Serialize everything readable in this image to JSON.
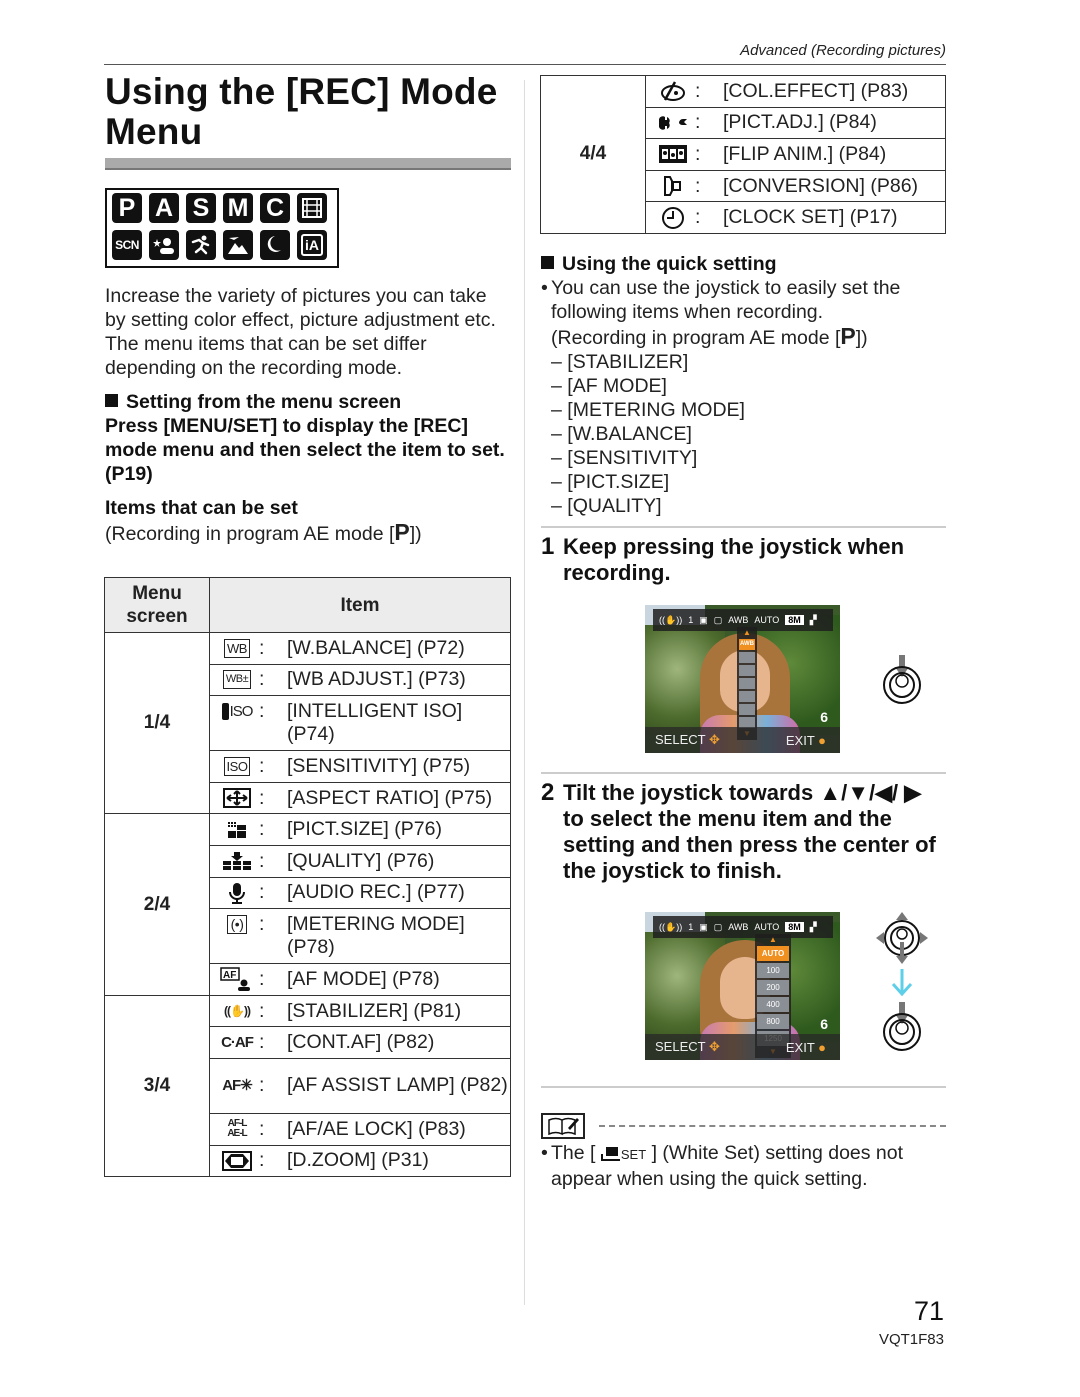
{
  "header": {
    "section": "Advanced (Recording pictures)"
  },
  "title": "Using the [REC] Mode Menu",
  "modes": {
    "row1": [
      {
        "label": "P",
        "icon": "program-ae-mode-icon"
      },
      {
        "label": "A",
        "icon": "aperture-priority-mode-icon"
      },
      {
        "label": "S",
        "icon": "shutter-priority-mode-icon"
      },
      {
        "label": "M",
        "icon": "manual-mode-icon"
      },
      {
        "label": "C",
        "icon": "custom-mode-icon"
      },
      {
        "label": "",
        "icon": "motion-picture-mode-icon"
      }
    ],
    "row2": [
      {
        "label": "SCN",
        "icon": "scene-mode-icon"
      },
      {
        "label": "",
        "icon": "portrait-mode-icon"
      },
      {
        "label": "",
        "icon": "sports-mode-icon"
      },
      {
        "label": "",
        "icon": "scenery-mode-icon"
      },
      {
        "label": "",
        "icon": "night-portrait-mode-icon"
      },
      {
        "label": "iA",
        "icon": "intelligent-auto-mode-icon"
      }
    ]
  },
  "intro": "Increase the variety of pictures you can take by setting color effect, picture adjustment etc. The menu items that can be set differ depending on the recording mode.",
  "menu_screen_section": {
    "heading": "Setting from the menu screen",
    "instruction": "Press [MENU/SET] to display the [REC] mode menu and then select the item to set. (P19)",
    "items_heading": "Items that can be set",
    "items_sub_prefix": "(Recording in program AE mode [",
    "items_sub_mode": "P",
    "items_sub_suffix": "])"
  },
  "table": {
    "headers": {
      "menu_screen": "Menu screen",
      "item": "Item"
    },
    "groups": [
      {
        "page": "1/4",
        "items": [
          {
            "icon_text": "WB",
            "icon": "white-balance-icon",
            "label": "[W.BALANCE] (P72)"
          },
          {
            "icon_text": "WB±",
            "icon": "wb-adjust-icon",
            "label": "[WB ADJUST.] (P73)"
          },
          {
            "icon_text": "ISO",
            "icon": "intelligent-iso-icon",
            "label": "[INTELLIGENT ISO] (P74)"
          },
          {
            "icon_text": "ISO",
            "icon": "sensitivity-icon",
            "label": "[SENSITIVITY] (P75)"
          },
          {
            "icon_text": "",
            "icon": "aspect-ratio-icon",
            "label": "[ASPECT RATIO] (P75)"
          }
        ]
      },
      {
        "page": "2/4",
        "items": [
          {
            "icon_text": "",
            "icon": "picture-size-icon",
            "label": "[PICT.SIZE] (P76)"
          },
          {
            "icon_text": "",
            "icon": "quality-icon",
            "label": "[QUALITY] (P76)"
          },
          {
            "icon_text": "",
            "icon": "microphone-icon",
            "label": "[AUDIO REC.] (P77)"
          },
          {
            "icon_text": "(•)",
            "icon": "metering-mode-icon",
            "label": "[METERING MODE] (P78)"
          },
          {
            "icon_text": "AF",
            "icon": "af-mode-icon",
            "label": "[AF MODE] (P78)"
          }
        ]
      },
      {
        "page": "3/4",
        "items": [
          {
            "icon_text": "((✋))",
            "icon": "stabilizer-icon",
            "label": "[STABILIZER] (P81)"
          },
          {
            "icon_text": "C·AF",
            "icon": "continuous-af-icon",
            "label": "[CONT.AF] (P82)"
          },
          {
            "icon_text": "AF✳",
            "icon": "af-assist-lamp-icon",
            "label": "[AF ASSIST LAMP] (P82)"
          },
          {
            "icon_text": "AF-L AE-L",
            "icon": "af-ae-lock-icon",
            "label": "[AF/AE LOCK] (P83)"
          },
          {
            "icon_text": "",
            "icon": "digital-zoom-icon",
            "label": "[D.ZOOM] (P31)"
          }
        ]
      },
      {
        "page": "4/4",
        "items": [
          {
            "icon_text": "",
            "icon": "color-effect-icon",
            "label": "[COL.EFFECT] (P83)"
          },
          {
            "icon_text": "",
            "icon": "picture-adjust-icon",
            "label": "[PICT.ADJ.] (P84)"
          },
          {
            "icon_text": "",
            "icon": "flip-animation-icon",
            "label": "[FLIP ANIM.] (P84)"
          },
          {
            "icon_text": "",
            "icon": "conversion-lens-icon",
            "label": "[CONVERSION] (P86)"
          },
          {
            "icon_text": "",
            "icon": "clock-icon",
            "label": "[CLOCK SET] (P17)"
          }
        ]
      }
    ],
    "colon": ":"
  },
  "quick_setting": {
    "heading": "Using the quick setting",
    "bullet_line1": "You can use the joystick to easily set the following items when recording.",
    "sub_prefix": "(Recording in program AE mode [",
    "sub_mode": "P",
    "sub_suffix": "])",
    "items": [
      "[STABILIZER]",
      "[AF MODE]",
      "[METERING MODE]",
      "[W.BALANCE]",
      "[SENSITIVITY]",
      "[PICT.SIZE]",
      "[QUALITY]"
    ],
    "dash": "–"
  },
  "steps": [
    {
      "number": "1",
      "text": "Keep pressing the joystick when recording."
    },
    {
      "number": "2",
      "text": "Tilt the joystick towards ▲/▼/◀/ ▶ to select the menu item and the setting and then press the center of the joystick to finish."
    }
  ],
  "screens": {
    "screen1": {
      "top": [
        "1",
        "AWB",
        "AUTO",
        "8M"
      ],
      "list": [
        "AWB",
        "",
        "",
        "",
        "",
        ""
      ],
      "selected": "AWB",
      "count": "6",
      "select": "SELECT",
      "exit": "EXIT"
    },
    "screen2": {
      "top": [
        "1",
        "AWB",
        "AUTO",
        "8M"
      ],
      "list": [
        "AUTO",
        "100",
        "200",
        "400",
        "800",
        "1250"
      ],
      "selected": "AUTO",
      "count": "6",
      "select": "SELECT",
      "exit": "EXIT"
    }
  },
  "note": {
    "bullet": "•",
    "prefix": "The [",
    "icon_text": "SET",
    "suffix": "] (White Set) setting does not appear when using the quick setting."
  },
  "footer": {
    "page_number": "71",
    "doc_code": "VQT1F83"
  }
}
